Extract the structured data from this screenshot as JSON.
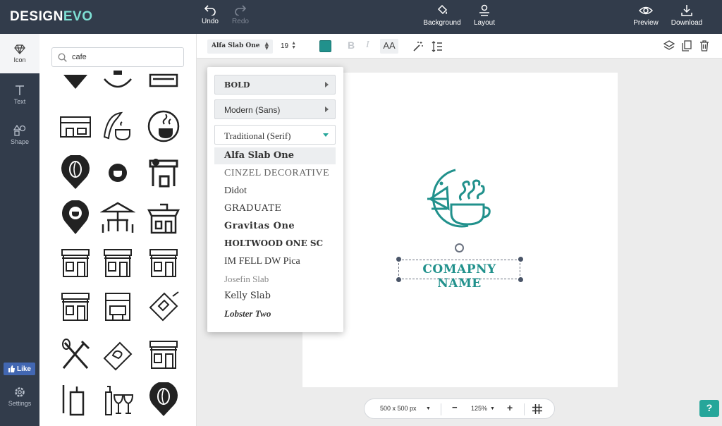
{
  "app": {
    "logo_design": "DESIGN",
    "logo_evo": "EVO"
  },
  "topbar": {
    "undo": "Undo",
    "redo": "Redo",
    "background": "Background",
    "layout": "Layout",
    "preview": "Preview",
    "download": "Download"
  },
  "rail": {
    "icon": "Icon",
    "text": "Text",
    "shape": "Shape",
    "like": "Like",
    "settings": "Settings"
  },
  "search": {
    "value": "cafe"
  },
  "toolbar": {
    "font": "Alfa Slab One",
    "size": "19",
    "bold": "B",
    "italic": "I",
    "case": "AA",
    "color": "#21918c"
  },
  "dropdown": {
    "categories": [
      "BOLD",
      "Modern (Sans)",
      "Traditional (Serif)"
    ],
    "fonts": [
      "Alfa Slab One",
      "CINZEL DECORATIVE",
      "Didot",
      "GRADUATE",
      "Gravitas One",
      "HOLTWOOD ONE SC",
      "IM FELL DW Pica",
      "Josefin Slab",
      "Kelly Slab",
      "Lobster Two"
    ],
    "selected_font": "Alfa Slab One"
  },
  "canvas": {
    "company_name": "COMAPNY NAME",
    "logo_color": "#21918c"
  },
  "bottom": {
    "canvas_size": "500 x 500 px",
    "zoom": "125%",
    "zoom_out": "−",
    "zoom_in": "+"
  },
  "help": {
    "label": "?"
  },
  "colors": {
    "topbar": "#323c4b",
    "accent": "#26a69a",
    "facebook": "#4267b2"
  },
  "icons": [
    "marker-cup-icon",
    "plate-cup-icon",
    "shop-awning-icon",
    "shop-front-icon",
    "croissant-coffee-icon",
    "coffee-swirl-badge-icon",
    "coffee-bean-marker-icon",
    "coffee-cup-dot-icon",
    "cafe-awning-icon",
    "coffee-location-icon",
    "table-umbrella-icon",
    "restaurant-building-icon",
    "storefront-icon",
    "storefront-icon",
    "storefront-icon",
    "storefront-icon",
    "shop-window-icon",
    "toast-board-icon",
    "utensils-icon",
    "bread-board-icon",
    "storefront-icon",
    "knife-board-icon",
    "wine-glasses-icon",
    "coffee-bean-pin-icon"
  ]
}
